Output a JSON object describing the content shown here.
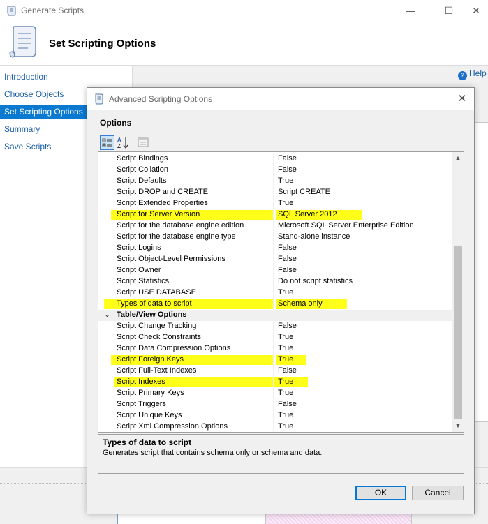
{
  "main_window": {
    "title": "Generate Scripts",
    "controls": {
      "minimize": "—",
      "maximize": "☐",
      "close": "✕"
    },
    "header_title": "Set Scripting Options",
    "help_label": "Help",
    "help_icon": "?",
    "nav_items": [
      {
        "label": "Introduction",
        "selected": false
      },
      {
        "label": "Choose Objects",
        "selected": false
      },
      {
        "label": "Set Scripting Options",
        "selected": true
      },
      {
        "label": "Summary",
        "selected": false
      },
      {
        "label": "Save Scripts",
        "selected": false
      }
    ]
  },
  "dialog": {
    "title": "Advanced Scripting Options",
    "close": "✕",
    "options_label": "Options",
    "toolbar": [
      "categorized-icon",
      "alphabetical-sort-icon",
      "property-pages-icon"
    ],
    "rows": [
      {
        "name": "Script Bindings",
        "value": "False"
      },
      {
        "name": "Script Collation",
        "value": "False"
      },
      {
        "name": "Script Defaults",
        "value": "True"
      },
      {
        "name": "Script DROP and CREATE",
        "value": "Script CREATE"
      },
      {
        "name": "Script Extended Properties",
        "value": "True"
      },
      {
        "name": "Script for Server Version",
        "value": "SQL Server 2012",
        "highlight": true
      },
      {
        "name": "Script for the database engine edition",
        "value": "Microsoft SQL Server Enterprise Edition"
      },
      {
        "name": "Script for the database engine type",
        "value": "Stand-alone instance"
      },
      {
        "name": "Script Logins",
        "value": "False"
      },
      {
        "name": "Script Object-Level Permissions",
        "value": "False"
      },
      {
        "name": "Script Owner",
        "value": "False"
      },
      {
        "name": "Script Statistics",
        "value": "Do not script statistics"
      },
      {
        "name": "Script USE DATABASE",
        "value": "True"
      },
      {
        "name": "Types of data to script",
        "value": "Schema only",
        "highlight": true
      },
      {
        "category": "Table/View Options",
        "toggle": "⌄"
      },
      {
        "name": "Script Change Tracking",
        "value": "False"
      },
      {
        "name": "Script Check Constraints",
        "value": "True"
      },
      {
        "name": "Script Data Compression Options",
        "value": "True"
      },
      {
        "name": "Script Foreign Keys",
        "value": "True",
        "highlight": true
      },
      {
        "name": "Script Full-Text Indexes",
        "value": "False"
      },
      {
        "name": "Script Indexes",
        "value": "True",
        "highlight": true
      },
      {
        "name": "Script Primary Keys",
        "value": "True"
      },
      {
        "name": "Script Triggers",
        "value": "False"
      },
      {
        "name": "Script Unique Keys",
        "value": "True"
      },
      {
        "name": "Script Xml Compression Options",
        "value": "True"
      }
    ],
    "scroll": {
      "up": "▲",
      "down": "▼"
    },
    "description": {
      "title": "Types of data to script",
      "text": "Generates script that contains schema only or schema and data."
    },
    "ok_label": "OK",
    "cancel_label": "Cancel"
  },
  "colors": {
    "selection_blue": "#0b79d0",
    "highlighter_yellow": "#ffff1a",
    "link_blue": "#1a5fa8"
  }
}
